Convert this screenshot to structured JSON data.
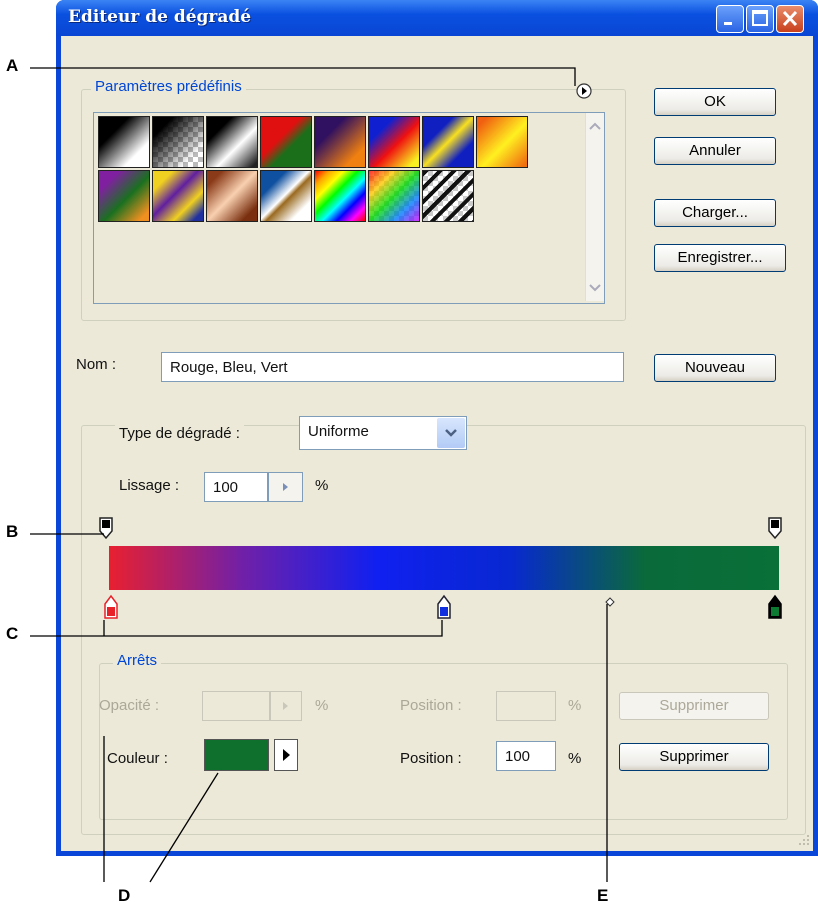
{
  "window": {
    "title": "Editeur de dégradé"
  },
  "presets": {
    "group_label": "Paramètres prédéfinis",
    "swatches": [
      {
        "name": "black-white-gradient",
        "bg": "linear-gradient(135deg,#000 30%,#fff 75%)"
      },
      {
        "name": "black-transparent-gradient",
        "bg": "linear-gradient(135deg,#000 20%,rgba(0,0,0,0) 80%),repeating-conic-gradient(#bbb 0 25%,#fff 0 50%) 0 0/10px 10px"
      },
      {
        "name": "black-white-black-gradient",
        "bg": "linear-gradient(135deg,#000 25%,#fff 60%,#222 95%)"
      },
      {
        "name": "red-green-gradient",
        "bg": "linear-gradient(135deg,#e01010 40%,#1b6f1b 60%)"
      },
      {
        "name": "violet-orange-gradient",
        "bg": "linear-gradient(135deg,#301060 30%,#f08010 80%)"
      },
      {
        "name": "blue-red-yellow-gradient",
        "bg": "linear-gradient(135deg,#1020d0 25%,#f01010 55%,#f8f020 90%)"
      },
      {
        "name": "blue-yellow-blue-gradient",
        "bg": "linear-gradient(135deg,#1020c0 30%,#f8e020 50%,#1020c0 75%)"
      },
      {
        "name": "orange-yellow-gradient",
        "bg": "linear-gradient(135deg,#f06010 10%,#fff020 55%,#f07010 95%)"
      },
      {
        "name": "violet-green-orange-gradient",
        "bg": "linear-gradient(135deg,#8020a0 20%,#1a7020 55%,#f09020 90%)"
      },
      {
        "name": "yellow-violet-stripes-gradient",
        "bg": "linear-gradient(135deg,#f0d020 20%,#6020a0 45%,#f0d020 70%,#2030a0 90%)"
      },
      {
        "name": "copper-gradient",
        "bg": "linear-gradient(135deg,#8a3a18 15%,#f8d0b0 50%,#7a3010 85%)"
      },
      {
        "name": "chrome-gradient",
        "bg": "linear-gradient(135deg,#1050a0 25%,#fff 48%,#9a6a20 55%,#fff 80%)"
      },
      {
        "name": "spectrum-gradient",
        "bg": "linear-gradient(135deg,red,orange,yellow,lime,cyan,blue,magenta,red)"
      },
      {
        "name": "transparent-rainbow-gradient",
        "bg": "linear-gradient(135deg,rgba(255,0,0,.8),rgba(255,200,0,.8),rgba(0,220,0,.8),rgba(0,120,255,.8),rgba(200,0,255,.8)),repeating-conic-gradient(#bbb 0 25%,#fff 0 50%) 0 0/10px 10px"
      },
      {
        "name": "transparent-stripes-gradient",
        "bg": "repeating-linear-gradient(135deg,#111 0 4px,rgba(0,0,0,0) 4px 10px),repeating-conic-gradient(#ccc 0 25%,#fff 0 50%) 0 0/10px 10px"
      }
    ]
  },
  "buttons": {
    "ok": "OK",
    "cancel": "Annuler",
    "load": "Charger...",
    "save": "Enregistrer...",
    "new": "Nouveau",
    "delete_opacity": "Supprimer",
    "delete_color": "Supprimer"
  },
  "name_row": {
    "label": "Nom :",
    "value": "Rouge, Bleu, Vert"
  },
  "gradient": {
    "type_label": "Type de dégradé :",
    "type_value": "Uniforme",
    "smoothness_label": "Lissage :",
    "smoothness_value": "100",
    "smoothness_unit": "%",
    "bar_colors": [
      "#e82030",
      "#7020a8",
      "#1020f0",
      "#0828d0",
      "#0a6a3a",
      "#097038"
    ],
    "color_stops": [
      {
        "name": "color-stop-red",
        "color": "#e82028",
        "selected": false
      },
      {
        "name": "color-stop-blue",
        "color": "#1030e0",
        "selected": false
      },
      {
        "name": "color-stop-green",
        "color": "#0c7a30",
        "selected": true
      }
    ]
  },
  "stops": {
    "group_label": "Arrêts",
    "opacity_label": "Opacité :",
    "opacity_value": "",
    "opacity_unit": "%",
    "opacity_position_label": "Position :",
    "opacity_position_value": "",
    "opacity_position_unit": "%",
    "color_label": "Couleur :",
    "color_value": "#0f6f2c",
    "color_position_label": "Position :",
    "color_position_value": "100",
    "color_position_unit": "%"
  },
  "annotations": {
    "a": "A",
    "b": "B",
    "c": "C",
    "d": "D",
    "e": "E"
  },
  "colors": {
    "title_blue": "#0a47d8",
    "dialog_bg": "#ece9d8",
    "group_label": "#0046d5"
  }
}
